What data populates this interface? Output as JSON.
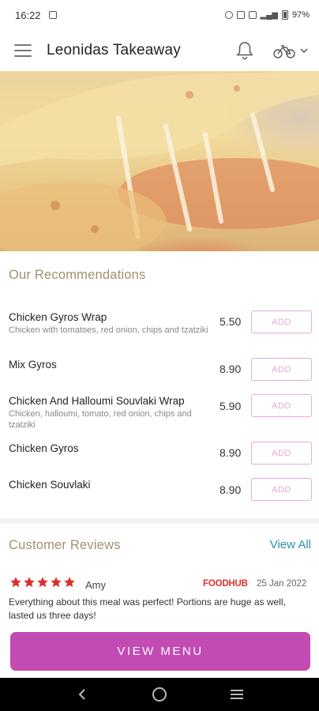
{
  "status_bar": {
    "time": "16:22",
    "battery": "97%"
  },
  "app_bar": {
    "title": "Leonidas Takeaway"
  },
  "recommendations": {
    "heading": "Our Recommendations",
    "add_label": "ADD",
    "items": [
      {
        "name": "Chicken Gyros Wrap",
        "description": "Chicken with tomatoes, red onion, chips and tzatziki",
        "price": "5.50"
      },
      {
        "name": "Mix Gyros",
        "description": "",
        "price": "8.90"
      },
      {
        "name": "Chicken And Halloumi Souvlaki Wrap",
        "description": "Chicken, halloumi, tomato, red onion, chips and tzatziki",
        "price": "5.90"
      },
      {
        "name": "Chicken Gyros",
        "description": "",
        "price": "8.90"
      },
      {
        "name": "Chicken Souvlaki",
        "description": "",
        "price": "8.90"
      }
    ]
  },
  "reviews": {
    "heading": "Customer Reviews",
    "view_all": "View All",
    "items": [
      {
        "rating": 5,
        "author": "Amy",
        "source": "FOODHUB",
        "date": "25 Jan 2022",
        "text": "Everything about this meal was perfect! Portions are huge as well, lasted us three days!"
      }
    ]
  },
  "cta": {
    "view_menu": "VIEW MENU"
  },
  "colors": {
    "accent": "#c24bb4",
    "add_button": "#e8a9d8",
    "section_title": "#a09070",
    "link": "#2d8ea8",
    "star": "#d9322d"
  }
}
